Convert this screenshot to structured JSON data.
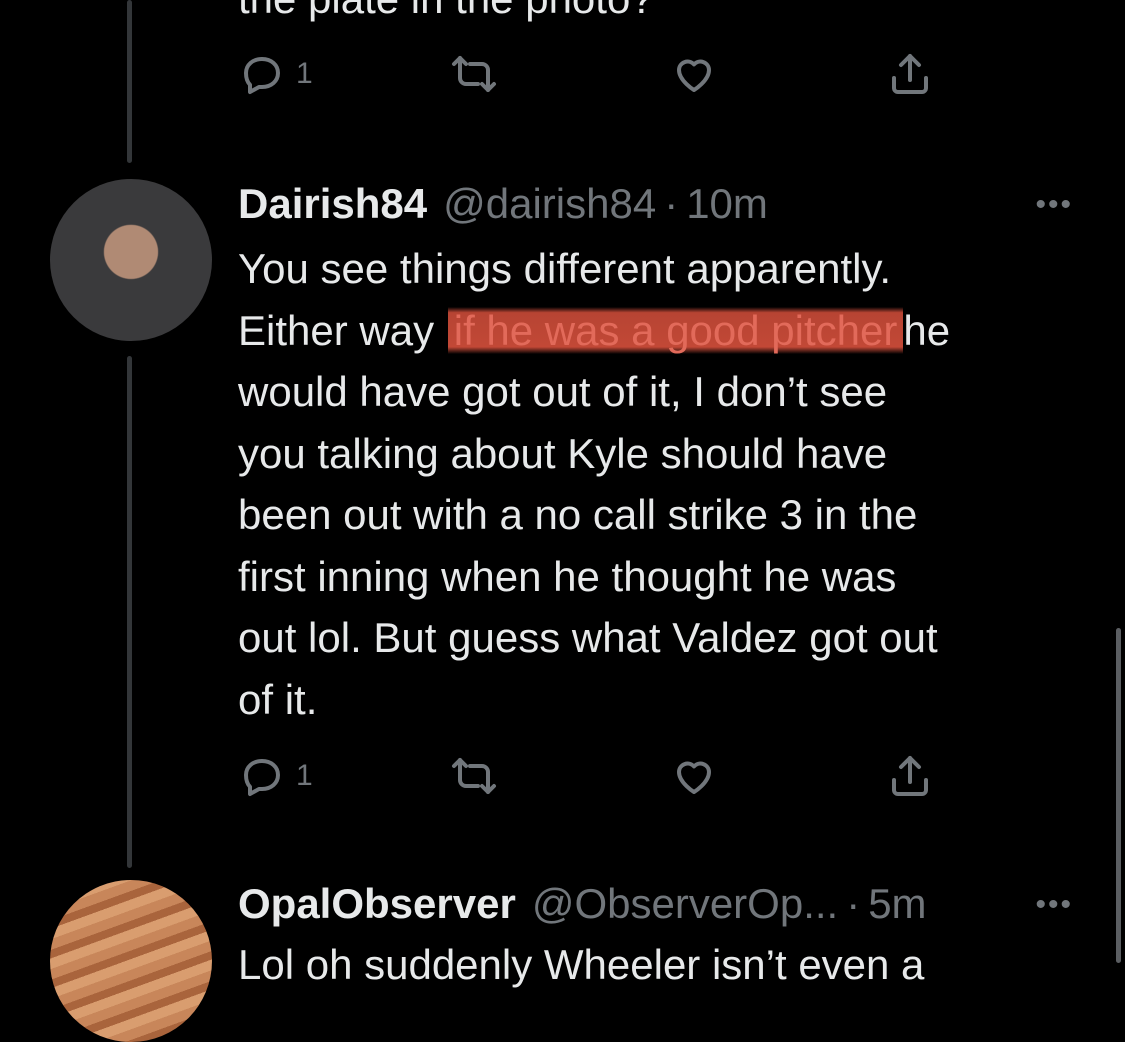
{
  "previous_tweet": {
    "partial_text": "the plate in the photo?",
    "actions": {
      "reply_count": "1"
    }
  },
  "tweet": {
    "display_name": "Dairish84",
    "handle": "@dairish84",
    "separator": "·",
    "time": "10m",
    "more": "•••",
    "lines": [
      "You see things different apparently.",
      "Either way",
      "if he was a good pitcher",
      "he",
      "would have got out of it, I don’t see",
      "you talking about Kyle should have",
      "been out with a no call strike 3 in the",
      "first inning when he thought he was",
      "out lol. But guess what Valdez got out",
      "of it."
    ],
    "actions": {
      "reply_count": "1"
    }
  },
  "next_tweet": {
    "display_name": "OpalObserver",
    "handle": "@ObserverOp...",
    "separator": "·",
    "time": "5m",
    "more": "•••",
    "partial_text": "Lol oh suddenly Wheeler isn’t even a"
  },
  "colors": {
    "background": "#000000",
    "text": "#e7e9ea",
    "muted": "#71767b",
    "highlight": "#d7503c"
  },
  "icons": [
    "reply-icon",
    "retweet-icon",
    "like-icon",
    "share-icon",
    "more-icon"
  ]
}
